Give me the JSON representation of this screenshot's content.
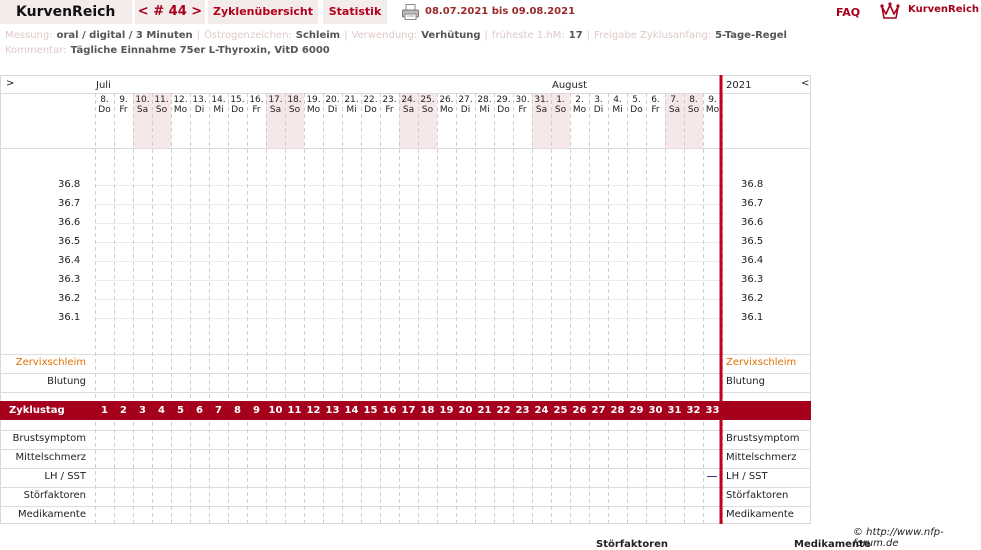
{
  "header": {
    "app_title": "KurvenReich",
    "nav_prev": "<",
    "cycle_label": "# 44",
    "nav_next": ">",
    "overview_label": "Zyklenübersicht",
    "stats_label": "Statistik",
    "date_range": "08.07.2021 bis 09.08.2021",
    "faq_label": "FAQ",
    "logo_text": "KurvenReich"
  },
  "info": {
    "messung_label": "Messung:",
    "messung_value": "oral / digital / 3 Minuten",
    "oestrogen_label": "Östrogenzeichen:",
    "oestrogen_value": "Schleim",
    "verwendung_label": "Verwendung:",
    "verwendung_value": "Verhütung",
    "hm_label": "früheste 1.hM:",
    "hm_value": "17",
    "freigabe_label": "Freigabe Zyklusanfang:",
    "freigabe_value": "5-Tage-Regel",
    "kommentar_label": "Kommentar:",
    "kommentar_value": "Tägliche Einnahme 75er L-Thyroxin, VitD 6000"
  },
  "chart": {
    "year": "2021",
    "nav_right": ">",
    "nav_left": "<",
    "months": [
      "Juli",
      "August"
    ],
    "days": [
      {
        "d": "8.",
        "w": "Do",
        "we": false
      },
      {
        "d": "9.",
        "w": "Fr",
        "we": false
      },
      {
        "d": "10.",
        "w": "Sa",
        "we": true
      },
      {
        "d": "11.",
        "w": "So",
        "we": true
      },
      {
        "d": "12.",
        "w": "Mo",
        "we": false
      },
      {
        "d": "13.",
        "w": "Di",
        "we": false
      },
      {
        "d": "14.",
        "w": "Mi",
        "we": false
      },
      {
        "d": "15.",
        "w": "Do",
        "we": false
      },
      {
        "d": "16.",
        "w": "Fr",
        "we": false
      },
      {
        "d": "17.",
        "w": "Sa",
        "we": true
      },
      {
        "d": "18.",
        "w": "So",
        "we": true
      },
      {
        "d": "19.",
        "w": "Mo",
        "we": false
      },
      {
        "d": "20.",
        "w": "Di",
        "we": false
      },
      {
        "d": "21.",
        "w": "Mi",
        "we": false
      },
      {
        "d": "22.",
        "w": "Do",
        "we": false
      },
      {
        "d": "23.",
        "w": "Fr",
        "we": false
      },
      {
        "d": "24.",
        "w": "Sa",
        "we": true
      },
      {
        "d": "25.",
        "w": "So",
        "we": true
      },
      {
        "d": "26.",
        "w": "Mo",
        "we": false
      },
      {
        "d": "27.",
        "w": "Di",
        "we": false
      },
      {
        "d": "28.",
        "w": "Mi",
        "we": false
      },
      {
        "d": "29.",
        "w": "Do",
        "we": false
      },
      {
        "d": "30.",
        "w": "Fr",
        "we": false
      },
      {
        "d": "31.",
        "w": "Sa",
        "we": true
      },
      {
        "d": "1.",
        "w": "So",
        "we": true
      },
      {
        "d": "2.",
        "w": "Mo",
        "we": false
      },
      {
        "d": "3.",
        "w": "Di",
        "we": false
      },
      {
        "d": "4.",
        "w": "Mi",
        "we": false
      },
      {
        "d": "5.",
        "w": "Do",
        "we": false
      },
      {
        "d": "6.",
        "w": "Fr",
        "we": false
      },
      {
        "d": "7.",
        "w": "Sa",
        "we": true
      },
      {
        "d": "8.",
        "w": "So",
        "we": true
      },
      {
        "d": "9.",
        "w": "Mo",
        "we": false
      }
    ],
    "temperatures": [
      "36.8",
      "36.7",
      "36.6",
      "36.5",
      "36.4",
      "36.3",
      "36.2",
      "36.1"
    ],
    "zyklustag_label": "Zyklustag",
    "zyklustage": [
      "1",
      "2",
      "3",
      "4",
      "5",
      "6",
      "7",
      "8",
      "9",
      "10",
      "11",
      "12",
      "13",
      "14",
      "15",
      "16",
      "17",
      "18",
      "19",
      "20",
      "21",
      "22",
      "23",
      "24",
      "25",
      "26",
      "27",
      "28",
      "29",
      "30",
      "31",
      "32",
      "33"
    ],
    "rows": {
      "zervix": "Zervixschleim",
      "blutung": "Blutung",
      "brust": "Brustsymptom",
      "mittel": "Mittelschmerz",
      "lh": "LH / SST",
      "stoer": "Störfaktoren",
      "medi": "Medikamente"
    },
    "lh_marker_day": 33
  },
  "footer": {
    "copyright": "© http://www.nfp-forum.de",
    "partial_stoer": "Störfaktoren",
    "partial_medi": "Medikamente"
  },
  "colors": {
    "accent": "#a5001c",
    "weekend": "#f6e8e8",
    "cervix_label": "#e07000"
  }
}
